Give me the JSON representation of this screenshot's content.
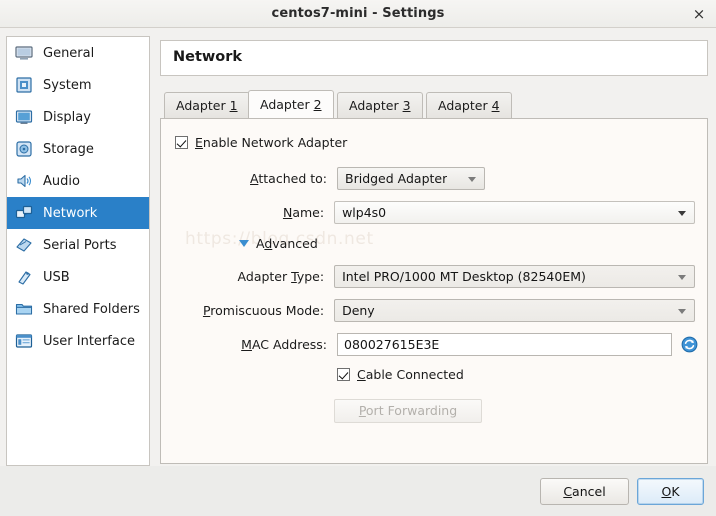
{
  "window": {
    "title": "centos7-mini - Settings",
    "close_label": "×"
  },
  "sidebar": {
    "items": [
      {
        "label": "General",
        "icon": "monitor-icon",
        "selected": false
      },
      {
        "label": "System",
        "icon": "motherboard-icon",
        "selected": false
      },
      {
        "label": "Display",
        "icon": "display-icon",
        "selected": false
      },
      {
        "label": "Storage",
        "icon": "disk-icon",
        "selected": false
      },
      {
        "label": "Audio",
        "icon": "speaker-icon",
        "selected": false
      },
      {
        "label": "Network",
        "icon": "network-icon",
        "selected": true
      },
      {
        "label": "Serial Ports",
        "icon": "serial-port-icon",
        "selected": false
      },
      {
        "label": "USB",
        "icon": "usb-icon",
        "selected": false
      },
      {
        "label": "Shared Folders",
        "icon": "folder-icon",
        "selected": false
      },
      {
        "label": "User Interface",
        "icon": "window-icon",
        "selected": false
      }
    ]
  },
  "pane": {
    "title": "Network",
    "tabs": [
      {
        "prefix": "Adapter ",
        "mnemonic": "1",
        "active": false
      },
      {
        "prefix": "Adapter ",
        "mnemonic": "2",
        "active": true
      },
      {
        "prefix": "Adapter ",
        "mnemonic": "3",
        "active": false
      },
      {
        "prefix": "Adapter ",
        "mnemonic": "4",
        "active": false
      }
    ],
    "watermark": "https://blog.csdn.net"
  },
  "form": {
    "enable_adapter": {
      "label_pre": "",
      "label_mnemonic": "E",
      "label_post": "nable Network Adapter",
      "checked": true
    },
    "attached_to": {
      "label_pre": "",
      "label_mnemonic": "A",
      "label_post": "ttached to:",
      "value": "Bridged Adapter"
    },
    "name": {
      "label_pre": "",
      "label_mnemonic": "N",
      "label_post": "ame:",
      "value": "wlp4s0"
    },
    "advanced": {
      "label_pre": "A",
      "label_mnemonic": "d",
      "label_post": "vanced",
      "expanded": true
    },
    "adapter_type": {
      "label_pre": "Adapter ",
      "label_mnemonic": "T",
      "label_post": "ype:",
      "value": "Intel PRO/1000 MT Desktop (82540EM)"
    },
    "promiscuous_mode": {
      "label_pre": "",
      "label_mnemonic": "P",
      "label_post": "romiscuous Mode:",
      "value": "Deny"
    },
    "mac_address": {
      "label_pre": "",
      "label_mnemonic": "M",
      "label_post": "AC Address:",
      "value": "080027615E3E",
      "refresh_icon": "refresh-mac-icon"
    },
    "cable_connected": {
      "label_pre": "",
      "label_mnemonic": "C",
      "label_post": "able Connected",
      "checked": true
    },
    "port_forwarding": {
      "label_pre": "",
      "label_mnemonic": "P",
      "label_post": "ort Forwarding",
      "enabled": false
    }
  },
  "footer": {
    "cancel": {
      "pre": "",
      "mnemonic": "C",
      "post": "ancel"
    },
    "ok": {
      "pre": "",
      "mnemonic": "O",
      "post": "K"
    }
  },
  "colors": {
    "selection_blue": "#2a80c8",
    "accent_blue": "#3b8ed0",
    "window_bg": "#ececea",
    "pane_bg": "#fdfaf7"
  }
}
